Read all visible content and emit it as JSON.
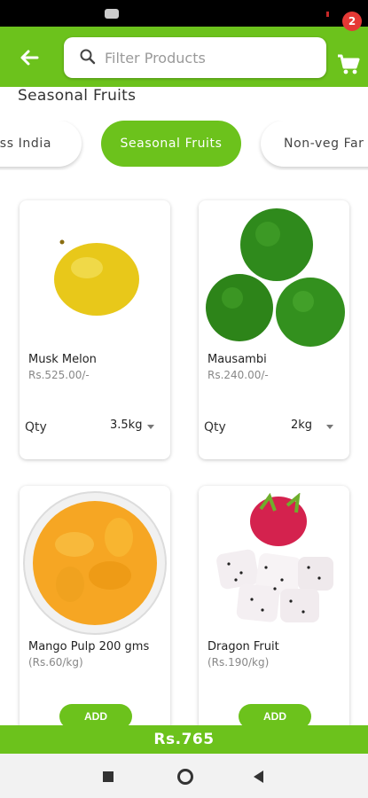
{
  "header": {
    "search_placeholder": "Filter Products",
    "cart_count": "2"
  },
  "section_title": "Seasonal Fruits",
  "categories": [
    {
      "label": "ss India",
      "selected": false
    },
    {
      "label": "Seasonal Fruits",
      "selected": true
    },
    {
      "label": "Non-veg Far",
      "selected": false
    }
  ],
  "products": [
    {
      "name": "Musk Melon",
      "price": "Rs.525.00/-",
      "qty_label": "Qty",
      "qty": "3.5kg"
    },
    {
      "name": "Mausambi",
      "price": "Rs.240.00/-",
      "qty_label": "Qty",
      "qty": "2kg"
    },
    {
      "name": "Mango Pulp 200 gms",
      "price": "(Rs.60/kg)",
      "add_label": "ADD"
    },
    {
      "name": "Dragon Fruit",
      "price": "(Rs.190/kg)",
      "add_label": "ADD"
    }
  ],
  "total": "Rs.765",
  "colors": {
    "accent": "#6cc21c",
    "badge": "#e53935"
  }
}
